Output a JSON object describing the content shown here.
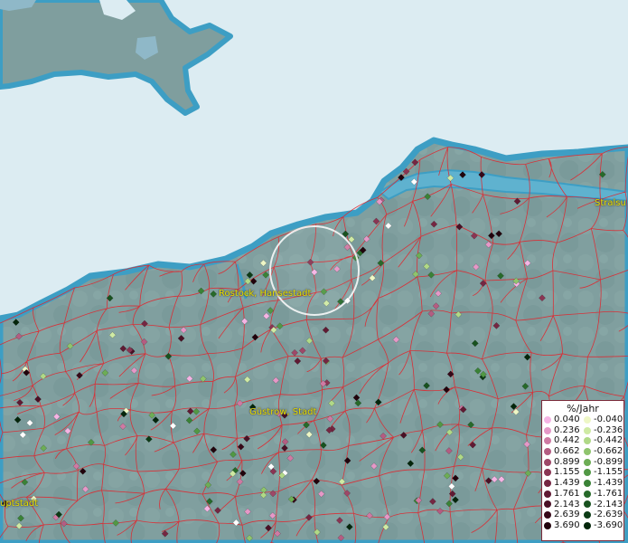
{
  "map": {
    "labels": {
      "rostock": "Rostock, Hansestadt",
      "guestrow": "Güstrow, Stadt",
      "stralsund": "Stralsu",
      "west": "uptstadt"
    },
    "legend": {
      "title": "%/Jahr",
      "positive": [
        {
          "label": "0.040",
          "color": "#f5b4e4"
        },
        {
          "label": "0.236",
          "color": "#e598c7"
        },
        {
          "label": "0.442",
          "color": "#cf7aa3"
        },
        {
          "label": "0.662",
          "color": "#b45d82"
        },
        {
          "label": "0.899",
          "color": "#9e4868"
        },
        {
          "label": "1.155",
          "color": "#8a3553"
        },
        {
          "label": "1.439",
          "color": "#752642"
        },
        {
          "label": "1.761",
          "color": "#601a33"
        },
        {
          "label": "2.143",
          "color": "#4a1025"
        },
        {
          "label": "2.639",
          "color": "#360818"
        },
        {
          "label": "3.690",
          "color": "#21030c"
        }
      ],
      "negative": [
        {
          "label": "-0.040",
          "color": "#eef7c6"
        },
        {
          "label": "-0.236",
          "color": "#cfeaa4"
        },
        {
          "label": "-0.442",
          "color": "#b0d987"
        },
        {
          "label": "-0.662",
          "color": "#8fc46d"
        },
        {
          "label": "-0.899",
          "color": "#6dad55"
        },
        {
          "label": "-1.155",
          "color": "#519844"
        },
        {
          "label": "-1.439",
          "color": "#3a8236"
        },
        {
          "label": "-1.761",
          "color": "#276a2a"
        },
        {
          "label": "-2.143",
          "color": "#18521f"
        },
        {
          "label": "-2.639",
          "color": "#0c3b15"
        },
        {
          "label": "-3.690",
          "color": "#04260b"
        }
      ]
    },
    "colors": {
      "sea": "#dcecf2",
      "land": "#7f9e9e",
      "coast": "#3d9ec4",
      "boundary": "#e0262e",
      "label": "#e8e000"
    }
  }
}
